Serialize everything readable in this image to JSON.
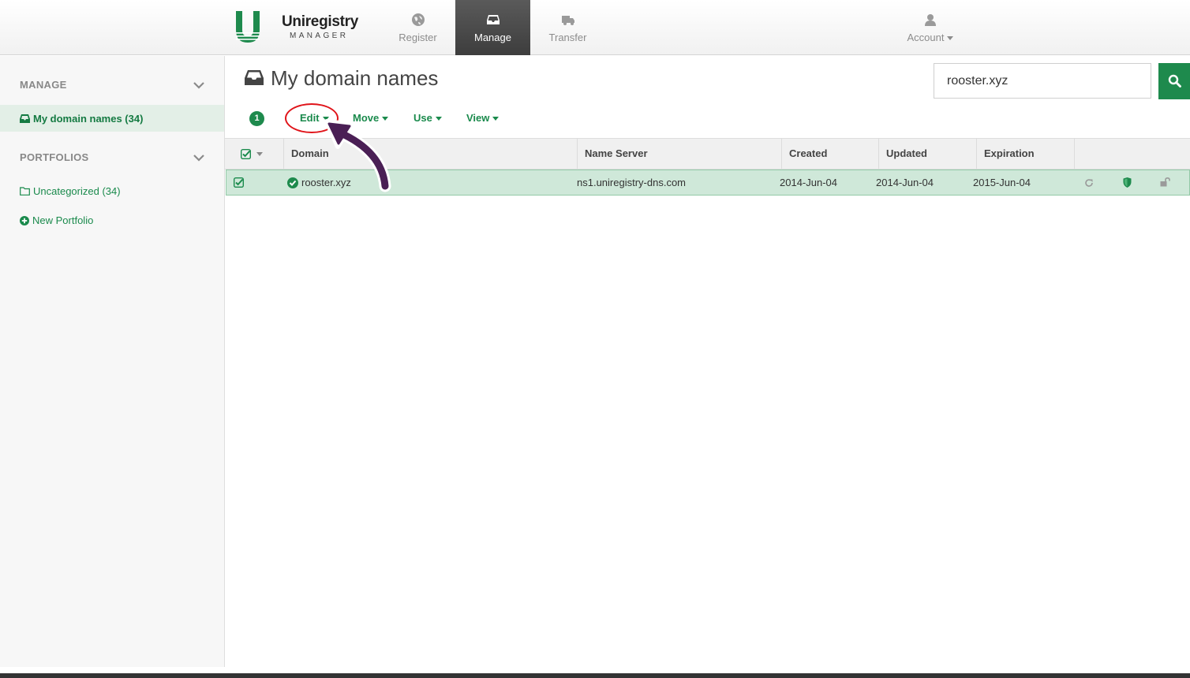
{
  "brand": {
    "name": "Uniregistry",
    "sub": "MANAGER",
    "color": "#1e8a4d"
  },
  "nav": {
    "register": "Register",
    "manage": "Manage",
    "transfer": "Transfer",
    "account": "Account"
  },
  "sidebar": {
    "manage_heading": "MANAGE",
    "my_domains": "My domain names (34)",
    "portfolios_heading": "PORTFOLIOS",
    "uncategorized": "Uncategorized (34)",
    "new_portfolio": "New Portfolio"
  },
  "main": {
    "title": "My domain names",
    "search_value": "rooster.xyz",
    "selected_count": "1",
    "toolbar": {
      "edit": "Edit",
      "move": "Move",
      "use": "Use",
      "view": "View"
    },
    "columns": [
      "Domain",
      "Name Server",
      "Created",
      "Updated",
      "Expiration"
    ],
    "rows": [
      {
        "domain": "rooster.xyz",
        "name_server": "ns1.uniregistry-dns.com",
        "created": "2014-Jun-04",
        "updated": "2014-Jun-04",
        "expiration": "2015-Jun-04"
      }
    ]
  }
}
